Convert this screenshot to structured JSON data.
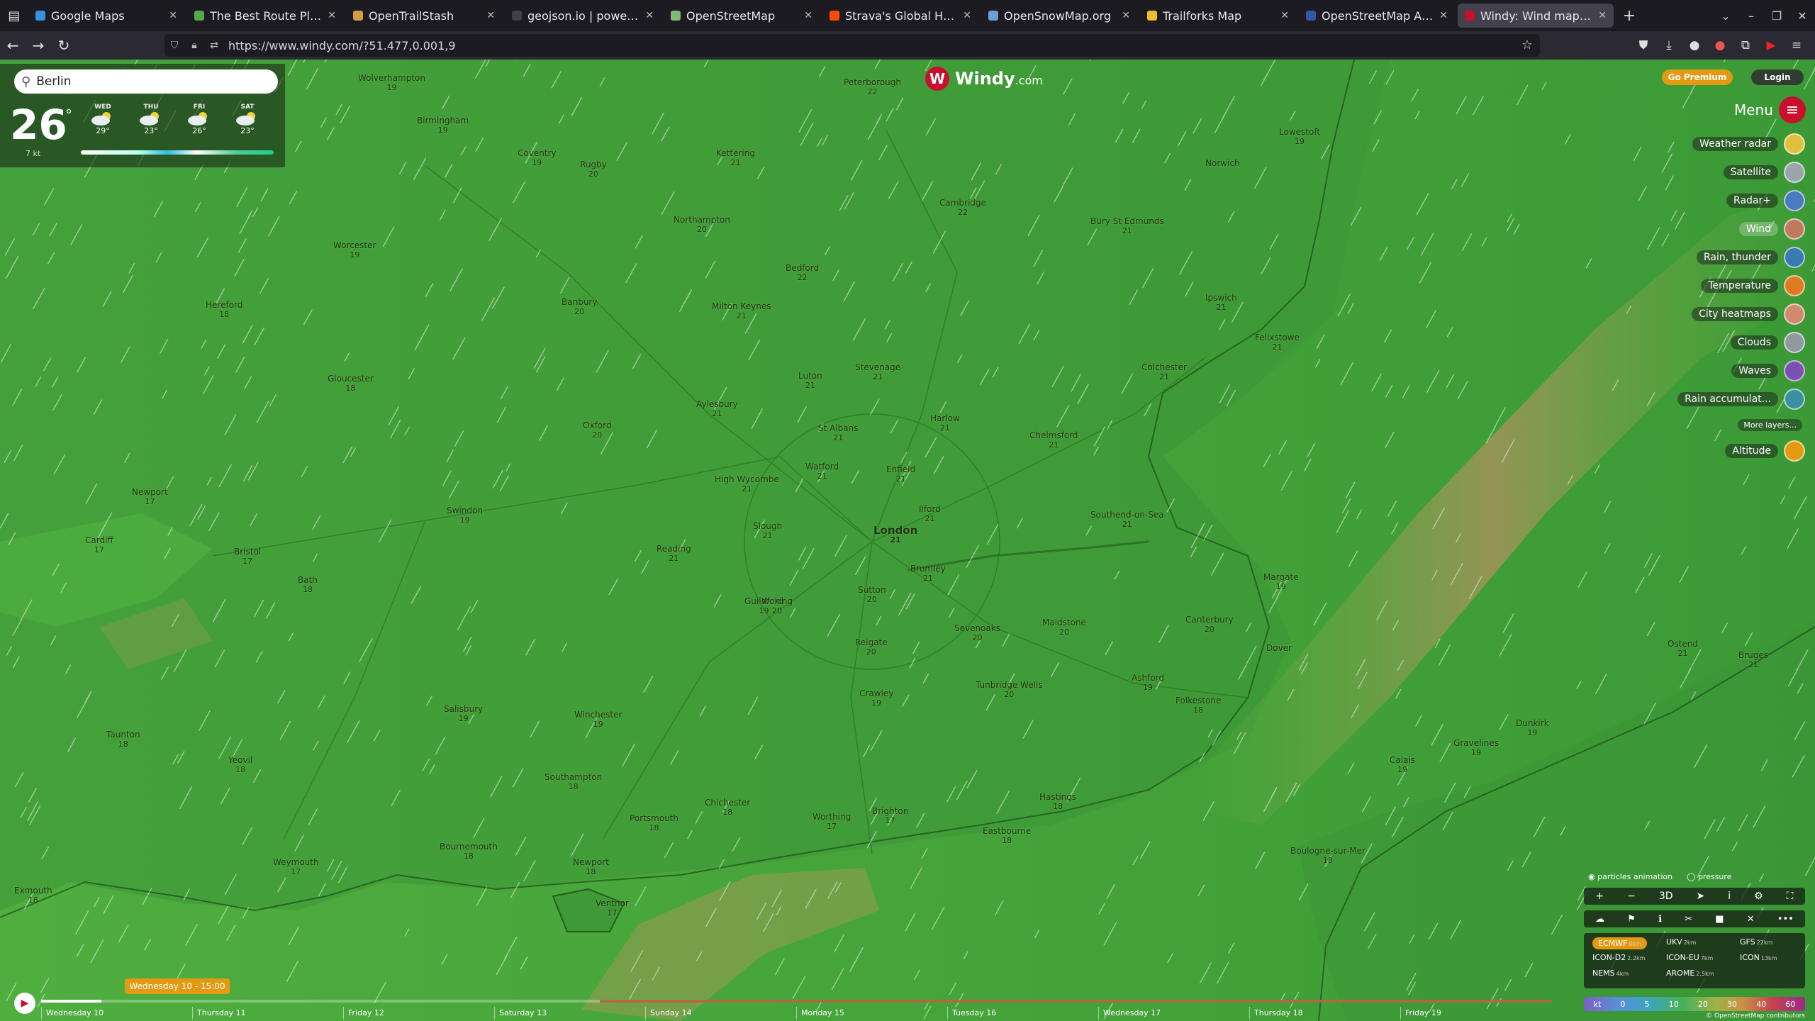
{
  "browser": {
    "tabs": [
      {
        "label": "Google Maps",
        "fav": "#3b8fe0",
        "active": false
      },
      {
        "label": "The Best Route Planner f",
        "fav": "#56a84a",
        "active": false
      },
      {
        "label": "OpenTrailStash",
        "fav": "#d0a040",
        "active": false
      },
      {
        "label": "geojson.io | powered by",
        "fav": "#404040",
        "active": false
      },
      {
        "label": "OpenStreetMap",
        "fav": "#7ebc6f",
        "active": false
      },
      {
        "label": "Strava's Global Heatmap",
        "fav": "#fc4c02",
        "active": false
      },
      {
        "label": "OpenSnowMap.org",
        "fav": "#6aa0d8",
        "active": false
      },
      {
        "label": "Trailforks Map",
        "fav": "#e8c030",
        "active": false
      },
      {
        "label": "OpenStreetMap America",
        "fav": "#3355aa",
        "active": false
      },
      {
        "label": "Windy: Wind map & weat",
        "fav": "#c8102e",
        "active": true
      }
    ],
    "new_tab": "+",
    "url": "https://www.windy.com/?51.477,0.001,9"
  },
  "windy": {
    "logo_text": "Windy",
    "logo_suffix": ".com",
    "go_premium": "Go Premium",
    "login": "Login",
    "menu_label": "Menu",
    "search_value": "Berlin",
    "current_temp": "26",
    "temp_unit": "°",
    "wind_now": "7 kt",
    "forecast_days": [
      {
        "day": "WED",
        "temp": "29°"
      },
      {
        "day": "THU",
        "temp": "23°"
      },
      {
        "day": "FRI",
        "temp": "26°"
      },
      {
        "day": "SAT",
        "temp": "23°"
      }
    ],
    "layers": [
      {
        "label": "Weather radar",
        "color": "#e0c040",
        "active": false
      },
      {
        "label": "Satellite",
        "color": "#9aa4aa",
        "active": false
      },
      {
        "label": "Radar+",
        "color": "#4a7ac0",
        "active": false
      },
      {
        "label": "Wind",
        "color": "#c07a60",
        "active": true
      },
      {
        "label": "Rain, thunder",
        "color": "#3a7ab0",
        "active": false
      },
      {
        "label": "Temperature",
        "color": "#e07a20",
        "active": false
      },
      {
        "label": "City heatmaps",
        "color": "#d08a70",
        "active": false
      },
      {
        "label": "Clouds",
        "color": "#9098a0",
        "active": false
      },
      {
        "label": "Waves",
        "color": "#7a50b0",
        "active": false
      },
      {
        "label": "Rain accumulat...",
        "color": "#3a90a0",
        "active": false
      }
    ],
    "more_layers": "More layers...",
    "altitude": "Altitude",
    "particles": "particles animation",
    "pressure": "pressure",
    "map_controls": [
      "+",
      "−",
      "3D",
      "➤",
      "i",
      "⚙",
      "⛶"
    ],
    "models": [
      {
        "name": "ECMWF",
        "res": "9km",
        "active": true
      },
      {
        "name": "UKV",
        "res": "2km",
        "active": false
      },
      {
        "name": "GFS",
        "res": "22km",
        "active": false
      },
      {
        "name": "ICON-D2",
        "res": "2.2km",
        "active": false
      },
      {
        "name": "ICON-EU",
        "res": "7km",
        "active": false
      },
      {
        "name": "ICON",
        "res": "13km",
        "active": false
      },
      {
        "name": "NEMS",
        "res": "4km",
        "active": false
      },
      {
        "name": "AROME",
        "res": "2.5km",
        "active": false
      }
    ],
    "legend": [
      "kt",
      "0",
      "5",
      "10",
      "20",
      "30",
      "40",
      "60"
    ],
    "copyright": "© OpenStreetMap contributors",
    "time_badge": "Wednesday 10 - 15:00",
    "timeline_progress": 0.04,
    "timeline_forecast_start": 0.37,
    "timeline_days": [
      "Wednesday 10",
      "Thursday 11",
      "Friday 12",
      "Saturday 13",
      "Sunday 14",
      "Monday 15",
      "Tuesday 16",
      "Wednesday 17",
      "Thursday 18",
      "Friday 19"
    ]
  },
  "places": [
    {
      "n": "Peterborough",
      "t": "22"
    },
    {
      "n": "Birmingham",
      "t": "19"
    },
    {
      "n": "Wolverhampton",
      "t": "19"
    },
    {
      "n": "Coventry",
      "t": "19"
    },
    {
      "n": "Northampton",
      "t": "20"
    },
    {
      "n": "Cambridge",
      "t": "22"
    },
    {
      "n": "Ipswich",
      "t": "21"
    },
    {
      "n": "Colchester",
      "t": "21"
    },
    {
      "n": "Oxford",
      "t": "20"
    },
    {
      "n": "Reading",
      "t": "21"
    },
    {
      "n": "London",
      "t": "21"
    },
    {
      "n": "Watford",
      "t": "21"
    },
    {
      "n": "Luton",
      "t": "21"
    },
    {
      "n": "Chelmsford",
      "t": "21"
    },
    {
      "n": "Southend-on-Sea",
      "t": "21"
    },
    {
      "n": "Maidstone",
      "t": "20"
    },
    {
      "n": "Canterbury",
      "t": "20"
    },
    {
      "n": "Margate",
      "t": "19"
    },
    {
      "n": "Brighton",
      "t": "17"
    },
    {
      "n": "Portsmouth",
      "t": "18"
    },
    {
      "n": "Southampton",
      "t": "18"
    },
    {
      "n": "Bournemouth",
      "t": "18"
    },
    {
      "n": "Salisbury",
      "t": "19"
    },
    {
      "n": "Swindon",
      "t": "19"
    },
    {
      "n": "Bristol",
      "t": "17"
    },
    {
      "n": "Bath",
      "t": "18"
    },
    {
      "n": "Cardiff",
      "t": "17"
    },
    {
      "n": "Newport",
      "t": "17"
    },
    {
      "n": "Gloucester",
      "t": "18"
    },
    {
      "n": "Hereford",
      "t": "18"
    },
    {
      "n": "Worcester",
      "t": "19"
    },
    {
      "n": "Guildford",
      "t": "19"
    },
    {
      "n": "Crawley",
      "t": "19"
    },
    {
      "n": "Hastings",
      "t": "18"
    },
    {
      "n": "Eastbourne",
      "t": "18"
    },
    {
      "n": "Folkestone",
      "t": "18"
    },
    {
      "n": "Ashford",
      "t": "19"
    },
    {
      "n": "Dover",
      "t": ""
    },
    {
      "n": "Calais",
      "t": "19"
    },
    {
      "n": "Dunkirk",
      "t": "19"
    },
    {
      "n": "Ostend",
      "t": "21"
    },
    {
      "n": "Bruges",
      "t": "21"
    },
    {
      "n": "Norwich",
      "t": ""
    },
    {
      "n": "Lowestoft",
      "t": "19"
    },
    {
      "n": "Felixstowe",
      "t": "21"
    },
    {
      "n": "Harlow",
      "t": "21"
    },
    {
      "n": "St Albans",
      "t": "21"
    },
    {
      "n": "Bedford",
      "t": "22"
    },
    {
      "n": "Milton Keynes",
      "t": "21"
    },
    {
      "n": "Aylesbury",
      "t": "21"
    },
    {
      "n": "High Wycombe",
      "t": "21"
    },
    {
      "n": "Slough",
      "t": "21"
    },
    {
      "n": "Woking",
      "t": "20"
    },
    {
      "n": "Winchester",
      "t": "19"
    },
    {
      "n": "Chichester",
      "t": "18"
    },
    {
      "n": "Worthing",
      "t": "17"
    },
    {
      "n": "Weymouth",
      "t": "17"
    },
    {
      "n": "Exmouth",
      "t": "18"
    },
    {
      "n": "Taunton",
      "t": "18"
    },
    {
      "n": "Yeovil",
      "t": "18"
    },
    {
      "n": "Boulogne-sur-Mer",
      "t": "18"
    },
    {
      "n": "Gravelines",
      "t": "19"
    },
    {
      "n": "Newport",
      "t": "18"
    },
    {
      "n": "Ventnor",
      "t": "17"
    },
    {
      "n": "Kettering",
      "t": "21"
    },
    {
      "n": "Rugby",
      "t": "20"
    },
    {
      "n": "Banbury",
      "t": "20"
    },
    {
      "n": "Bury St Edmunds",
      "t": "21"
    },
    {
      "n": "Stevenage",
      "t": "21"
    },
    {
      "n": "Enfield",
      "t": "21"
    },
    {
      "n": "Ilford",
      "t": "21"
    },
    {
      "n": "Bromley",
      "t": "21"
    },
    {
      "n": "Sutton",
      "t": "20"
    },
    {
      "n": "Reigate",
      "t": "20"
    },
    {
      "n": "Sevenoaks",
      "t": "20"
    },
    {
      "n": "Tunbridge Wells",
      "t": "20"
    }
  ]
}
